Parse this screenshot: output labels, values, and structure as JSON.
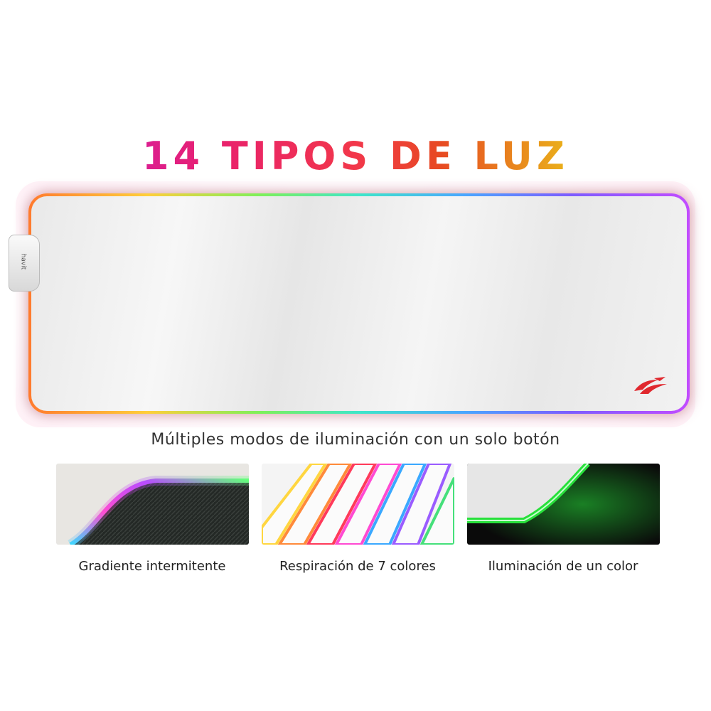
{
  "headline": "14 TIPOS DE LUZ",
  "connector_brand": "havit",
  "subtitle": "Múltiples modos de iluminación con un solo botón",
  "modes": [
    {
      "caption": "Gradiente intermitente"
    },
    {
      "caption": "Respiración de 7 colores"
    },
    {
      "caption": "Iluminación de un color"
    }
  ],
  "colors": {
    "rgb_edge": [
      "#ff7a2e",
      "#ffce3a",
      "#7ef05a",
      "#3fe6c9",
      "#4aa6ff",
      "#7d5cff",
      "#c24cff"
    ],
    "logo": "#e0282e",
    "single_color": "#27e03a"
  }
}
